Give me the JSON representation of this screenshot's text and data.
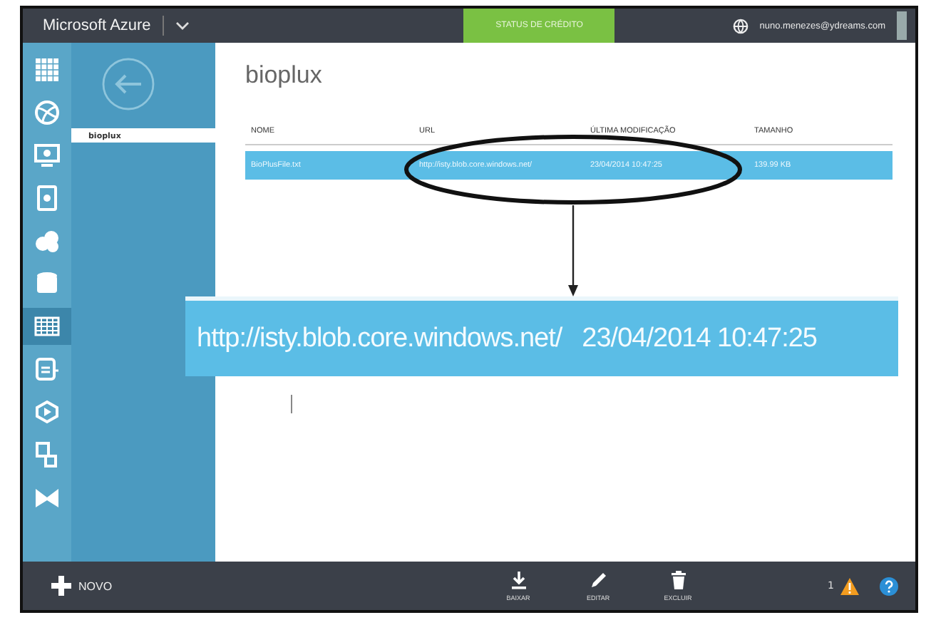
{
  "top_bar": {
    "title": "Microsoft Azure",
    "credit_button": "STATUS DE CRÉDITO",
    "user": "nuno.menezes@ydreams.com"
  },
  "sidebar_icons": [
    {
      "selected": false
    },
    {
      "selected": false
    },
    {
      "selected": false
    },
    {
      "selected": false
    },
    {
      "selected": false
    },
    {
      "selected": false
    },
    {
      "selected": true
    },
    {
      "selected": false
    },
    {
      "selected": false
    },
    {
      "selected": false
    },
    {
      "selected": false
    }
  ],
  "nav": {
    "items": [
      {
        "label": "bioplux",
        "selected": true
      }
    ]
  },
  "page_title": "bioplux",
  "table": {
    "columns": [
      "NOME",
      "URL",
      "ÚLTIMA MODIFICAÇÃO",
      "TAMANHO"
    ],
    "rows": [
      {
        "selected": true,
        "cells": [
          "BioPlusFile.txt",
          "http://isty.blob.core.windows.net/",
          "23/04/2014 10:47:25",
          "139.99 KB"
        ]
      }
    ]
  },
  "callout": {
    "texts": [
      "http://isty.blob.core.windows.net/",
      "23/04/2014 10:47:25"
    ]
  },
  "command_bar": {
    "new_button": "NOVO",
    "actions": [
      {
        "kind": "download",
        "label": "BAIXAR"
      },
      {
        "kind": "edit",
        "label": "EDITAR"
      },
      {
        "kind": "delete",
        "label": "EXCLUIR"
      }
    ],
    "warning_count": "1"
  }
}
